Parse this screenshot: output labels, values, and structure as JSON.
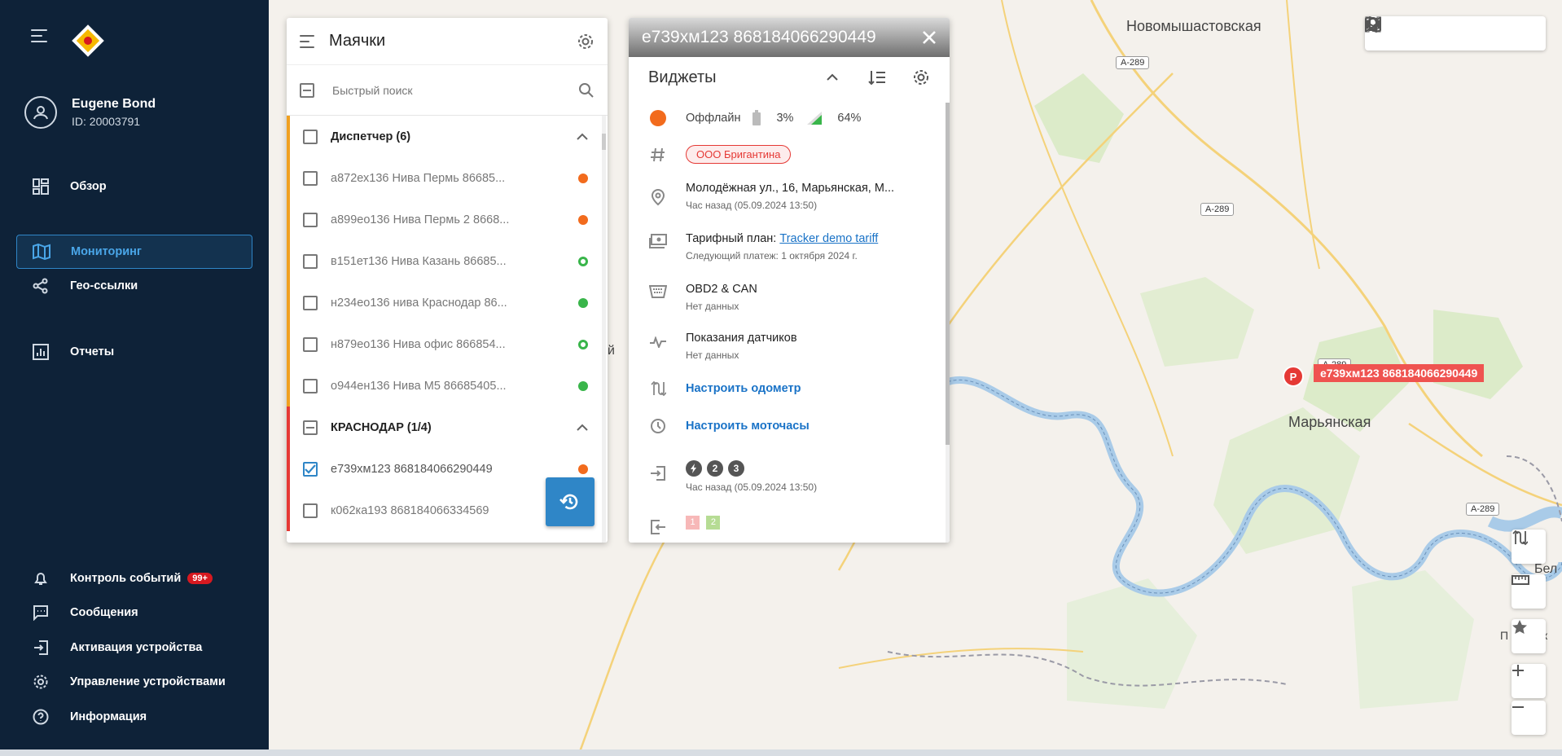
{
  "sidebar": {
    "user": {
      "name": "Eugene Bond",
      "id": "ID: 20003791"
    },
    "nav": [
      {
        "label": "Обзор",
        "icon": "dashboard-icon"
      },
      {
        "label": "Мониторинг",
        "icon": "map-icon",
        "active": true
      },
      {
        "label": "Гео-ссылки",
        "icon": "share-icon"
      },
      {
        "label": "Отчеты",
        "icon": "chart-icon"
      }
    ],
    "bottom_nav": [
      {
        "label": "Контроль событий",
        "badge": "99+",
        "icon": "bell-icon"
      },
      {
        "label": "Сообщения",
        "icon": "message-icon"
      },
      {
        "label": "Активация устройства",
        "icon": "login-icon"
      },
      {
        "label": "Управление устройствами",
        "icon": "gear-icon"
      },
      {
        "label": "Информация",
        "icon": "help-icon"
      }
    ]
  },
  "beacons": {
    "title": "Маячки",
    "search_placeholder": "Быстрый поиск",
    "group1": {
      "label": "Диспетчер (6)",
      "color": "#f0a020"
    },
    "items1": [
      {
        "label": "а872ех136 Нива Пермь 86685...",
        "status": "#f26b1d"
      },
      {
        "label": "а899ео136 Нива Пермь 2 8668...",
        "status": "#f26b1d"
      },
      {
        "label": "в151ет136 Нива Казань 86685...",
        "status": "#39b54a",
        "hollow": true
      },
      {
        "label": "н234ео136 нива Краснодар 86...",
        "status": "#39b54a"
      },
      {
        "label": "н879ео136 Нива офис 866854...",
        "status": "#39b54a",
        "hollow": true
      },
      {
        "label": "о944ен136 Нива М5 86685405...",
        "status": "#39b54a"
      }
    ],
    "group2": {
      "label": "КРАСНОДАР (1/4)",
      "color": "#e53935"
    },
    "items2": [
      {
        "label": "е739хм123 868184066290449",
        "status": "#f26b1d",
        "checked": true
      },
      {
        "label": "к062ка193 868184066334569"
      }
    ]
  },
  "object_panel": {
    "title": "е739хм123 868184066290449",
    "widgets_title": "Виджеты",
    "status": {
      "label": "Оффлайн",
      "battery": "3%",
      "signal": "64%",
      "color": "#f26b1d"
    },
    "tag": "ООО Бригантина",
    "address": {
      "main": "Молодёжная ул., 16, Марьянская, М...",
      "sub": "Час назад (05.09.2024 13:50)"
    },
    "tariff": {
      "label": "Тарифный план:",
      "link": "Tracker demo tariff",
      "sub": "Следующий платеж: 1 октября 2024 г."
    },
    "obd": {
      "main": "OBD2 & CAN",
      "sub": "Нет данных"
    },
    "sensors": {
      "main": "Показания датчиков",
      "sub": "Нет данных"
    },
    "odometer": "Настроить одометр",
    "motohours": "Настроить моточасы",
    "inputs": {
      "nums": [
        "2",
        "3"
      ],
      "sub": "Час назад (05.09.2024 13:50)"
    },
    "outputs": [
      "1",
      "2"
    ]
  },
  "map": {
    "labels": {
      "town1": "Новомышастовская",
      "town2": "Марьянская",
      "edge1": "й",
      "edge2": "Бел",
      "edge3": "П",
      "edge4": "к"
    },
    "roads": [
      "А-289",
      "А-289",
      "А-289",
      "А-289"
    ],
    "marker": {
      "letter": "Р",
      "label": "е739хм123 868184066290449"
    }
  }
}
